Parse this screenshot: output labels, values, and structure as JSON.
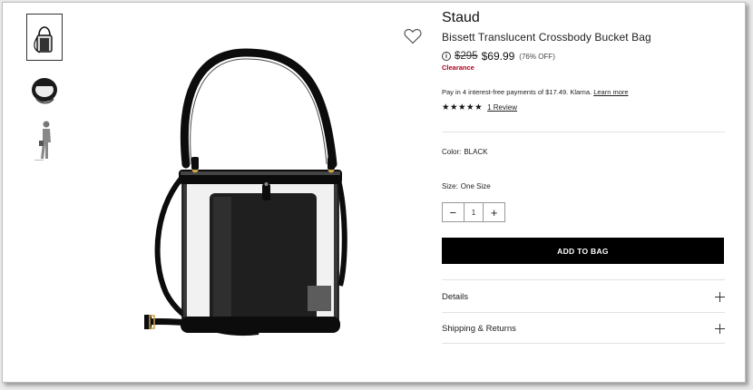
{
  "product": {
    "brand": "Staud",
    "title": "Bissett Translucent Crossbody Bucket Bag",
    "info_icon": "i",
    "original_price": "$295",
    "sale_price": "$69.99",
    "discount": "(76% OFF)",
    "clearance": "Clearance"
  },
  "klarna": {
    "text": "Pay in 4 interest-free payments of $17.49. Klarna.",
    "learn_more": "Learn more"
  },
  "rating": {
    "stars": "★★★★★",
    "value": 5,
    "reviews": "1 Review"
  },
  "options": {
    "color_label": "Color:",
    "color_value": "BLACK",
    "size_label": "Size:",
    "size_value": "One Size"
  },
  "quantity": {
    "minus": "−",
    "value": "1",
    "plus": "+"
  },
  "add_to_bag": "ADD TO BAG",
  "accordions": [
    {
      "label": "Details"
    },
    {
      "label": "Shipping & Returns"
    }
  ],
  "icons": {
    "wishlist": "heart-icon",
    "expand": "plus-icon"
  },
  "colors": {
    "clearance": "#b00020",
    "button_bg": "#000000",
    "button_text": "#ffffff"
  }
}
